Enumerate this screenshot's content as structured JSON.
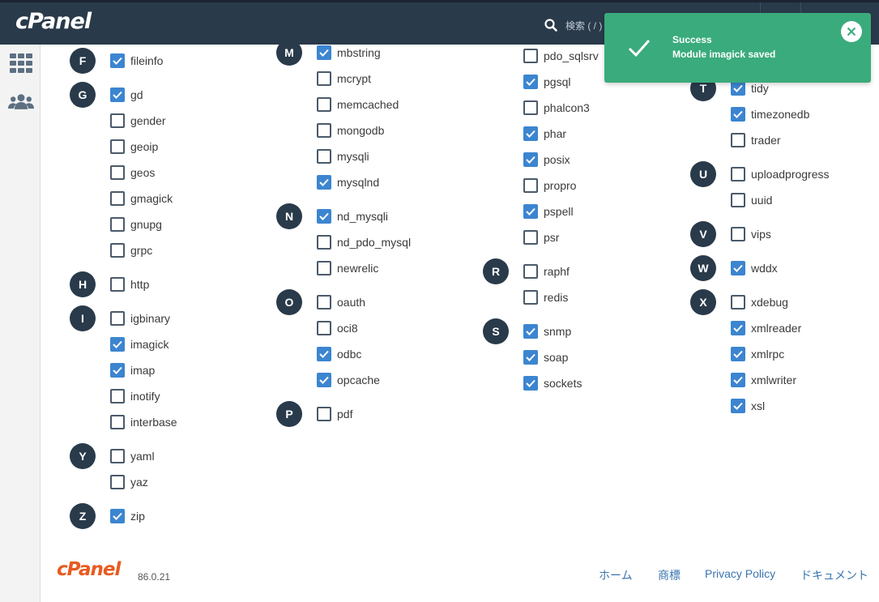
{
  "header": {
    "logo": "cPanel",
    "search_placeholder": "検索 ( / )"
  },
  "sidebar": {
    "icons": [
      "grid-icon",
      "users-icon"
    ]
  },
  "toast": {
    "title": "Success",
    "message": "Module imagick saved"
  },
  "modules": {
    "col1": [
      {
        "letter": "F",
        "items": [
          {
            "name": "fileinfo",
            "checked": true
          }
        ]
      },
      {
        "letter": "G",
        "items": [
          {
            "name": "gd",
            "checked": true
          },
          {
            "name": "gender",
            "checked": false
          },
          {
            "name": "geoip",
            "checked": false
          },
          {
            "name": "geos",
            "checked": false
          },
          {
            "name": "gmagick",
            "checked": false
          },
          {
            "name": "gnupg",
            "checked": false
          },
          {
            "name": "grpc",
            "checked": false
          }
        ]
      },
      {
        "letter": "H",
        "items": [
          {
            "name": "http",
            "checked": false
          }
        ]
      },
      {
        "letter": "I",
        "items": [
          {
            "name": "igbinary",
            "checked": false
          },
          {
            "name": "imagick",
            "checked": true
          },
          {
            "name": "imap",
            "checked": true
          },
          {
            "name": "inotify",
            "checked": false
          },
          {
            "name": "interbase",
            "checked": false
          }
        ]
      },
      {
        "letter": "Y",
        "items": [
          {
            "name": "yaml",
            "checked": false
          },
          {
            "name": "yaz",
            "checked": false
          }
        ]
      },
      {
        "letter": "Z",
        "items": [
          {
            "name": "zip",
            "checked": true
          }
        ]
      }
    ],
    "col2": [
      {
        "letter": "M",
        "items": [
          {
            "name": "mbstring",
            "checked": true
          },
          {
            "name": "mcrypt",
            "checked": false
          },
          {
            "name": "memcached",
            "checked": false
          },
          {
            "name": "mongodb",
            "checked": false
          },
          {
            "name": "mysqli",
            "checked": false
          },
          {
            "name": "mysqlnd",
            "checked": true
          }
        ]
      },
      {
        "letter": "N",
        "items": [
          {
            "name": "nd_mysqli",
            "checked": true
          },
          {
            "name": "nd_pdo_mysql",
            "checked": false
          },
          {
            "name": "newrelic",
            "checked": false
          }
        ]
      },
      {
        "letter": "O",
        "items": [
          {
            "name": "oauth",
            "checked": false
          },
          {
            "name": "oci8",
            "checked": false
          },
          {
            "name": "odbc",
            "checked": true
          },
          {
            "name": "opcache",
            "checked": true
          }
        ]
      },
      {
        "letter": "P",
        "items": [
          {
            "name": "pdf",
            "checked": false
          }
        ]
      }
    ],
    "col3": [
      {
        "letter": "",
        "items": [
          {
            "name": "pdo_sqlsrv",
            "checked": false
          },
          {
            "name": "pgsql",
            "checked": true
          },
          {
            "name": "phalcon3",
            "checked": false
          },
          {
            "name": "phar",
            "checked": true
          },
          {
            "name": "posix",
            "checked": true
          },
          {
            "name": "propro",
            "checked": false
          },
          {
            "name": "pspell",
            "checked": true
          },
          {
            "name": "psr",
            "checked": false
          }
        ]
      },
      {
        "letter": "R",
        "items": [
          {
            "name": "raphf",
            "checked": false
          },
          {
            "name": "redis",
            "checked": false
          }
        ]
      },
      {
        "letter": "S",
        "items": [
          {
            "name": "snmp",
            "checked": true
          },
          {
            "name": "soap",
            "checked": true
          },
          {
            "name": "sockets",
            "checked": true
          }
        ]
      }
    ],
    "col4": [
      {
        "letter": "T",
        "items": [
          {
            "name": "tidy",
            "checked": true
          },
          {
            "name": "timezonedb",
            "checked": true
          },
          {
            "name": "trader",
            "checked": false
          }
        ]
      },
      {
        "letter": "U",
        "items": [
          {
            "name": "uploadprogress",
            "checked": false
          },
          {
            "name": "uuid",
            "checked": false
          }
        ]
      },
      {
        "letter": "V",
        "items": [
          {
            "name": "vips",
            "checked": false
          }
        ]
      },
      {
        "letter": "W",
        "items": [
          {
            "name": "wddx",
            "checked": true
          }
        ]
      },
      {
        "letter": "X",
        "items": [
          {
            "name": "xdebug",
            "checked": false
          },
          {
            "name": "xmlreader",
            "checked": true
          },
          {
            "name": "xmlrpc",
            "checked": true
          },
          {
            "name": "xmlwriter",
            "checked": true
          },
          {
            "name": "xsl",
            "checked": true
          }
        ]
      }
    ]
  },
  "footer": {
    "logo": "cPanel",
    "version": "86.0.21",
    "links": [
      "ホーム",
      "商標",
      "Privacy Policy",
      "ドキュメント"
    ]
  },
  "colors": {
    "topbar": "#293a4a",
    "accent_checkbox": "#3c85d0",
    "toast_success": "#3aab7c",
    "footer_logo": "#e75b1f",
    "link": "#3a75b0"
  }
}
